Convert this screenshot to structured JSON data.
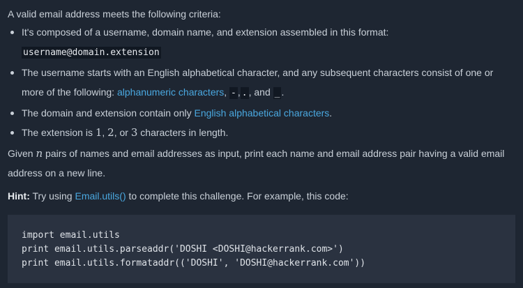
{
  "intro": "A valid email address meets the following criteria:",
  "criteria": {
    "item1": {
      "text": "It's composed of a username, domain name, and extension assembled in this format:",
      "format": "username@domain.extension"
    },
    "item2": {
      "text_before": "The username starts with an English alphabetical character, and any subsequent characters consist of one or more of the following: ",
      "link": "alphanumeric characters",
      "sep1": ", ",
      "char_dash": "-",
      "sep2": ",",
      "char_dot": ".",
      "sep3": ", and ",
      "char_underscore": "_",
      "end": "."
    },
    "item3": {
      "text_before": "The domain and extension contain only ",
      "link": "English alphabetical characters",
      "end": "."
    },
    "item4": {
      "text_before": "The extension is ",
      "n1": "1",
      "sep1": ", ",
      "n2": "2",
      "sep2": ", or ",
      "n3": "3",
      "text_after": " characters in length."
    }
  },
  "given": {
    "text_before": "Given ",
    "var": "n",
    "text_after": " pairs of names and email addresses as input, print each name and email address pair having a valid email address on a new line."
  },
  "hint": {
    "label": "Hint:",
    "text_before": " Try using ",
    "link": "Email.utils()",
    "text_after": " to complete this challenge. For example, this code:"
  },
  "code": {
    "lines": [
      "import email.utils",
      "print email.utils.parseaddr('DOSHI <DOSHI@hackerrank.com>')",
      "print email.utils.formataddr(('DOSHI', 'DOSHI@hackerrank.com'))"
    ]
  }
}
